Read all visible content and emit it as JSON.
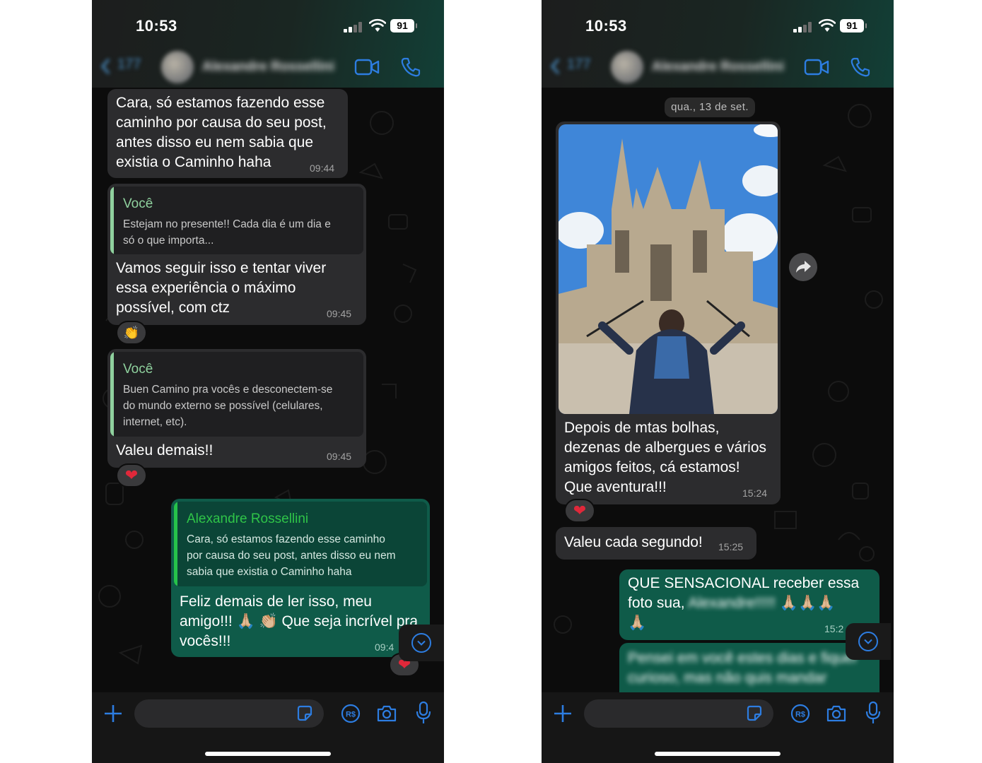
{
  "colors": {
    "incoming_bubble": "#2c2c2e",
    "outgoing_bubble": "#0f5b49",
    "accent_blue": "#2d7de1",
    "quote_author_green": "#8fd19e",
    "out_quote_author_green": "#2fc448"
  },
  "left": {
    "status": {
      "time": "10:53",
      "battery": "91"
    },
    "header": {
      "back_count": "177",
      "contact_name": "Alexandre Rossellini"
    },
    "messages": {
      "m1": {
        "line1": "Cara, só estamos fazendo esse",
        "line2": "caminho por causa do seu post,",
        "line3": "antes disso eu nem sabia que",
        "line4": "existia o Caminho haha",
        "time": "09:44"
      },
      "m2": {
        "quote_author": "Você",
        "quote_line1": "Estejam no presente!! Cada dia é um dia e",
        "quote_line2": "só o que importa...",
        "line1": "Vamos seguir isso e tentar viver",
        "line2": "essa experiência o máximo",
        "line3": "possível, com ctz",
        "time": "09:45",
        "reaction": "👏"
      },
      "m3": {
        "quote_author": "Você",
        "quote_line1": "Buen Camino pra vocês e desconectem-se",
        "quote_line2": "do mundo externo se possível (celulares,",
        "quote_line3": "internet, etc).",
        "line1": "Valeu demais!!",
        "time": "09:45",
        "reaction": "❤"
      },
      "m4": {
        "quote_author": "Alexandre Rossellini",
        "quote_line1": "Cara, só estamos fazendo esse caminho",
        "quote_line2": "por causa do seu post, antes disso eu nem",
        "quote_line3": "sabia que existia o Caminho haha",
        "line1": "Feliz demais de ler isso, meu",
        "line2": "amigo!!! 🙏🏼 👏🏼 Que seja incrível pra",
        "line3": "vocês!!!",
        "time": "09:4",
        "reaction": "❤"
      }
    }
  },
  "right": {
    "status": {
      "time": "10:53",
      "battery": "91"
    },
    "header": {
      "back_count": "177",
      "contact_name": "Alexandre Rossellini"
    },
    "date_separator": "qua., 13 de set.",
    "messages": {
      "photo_msg": {
        "photo_icon": "cathedral-photo",
        "line1": "Depois de mtas bolhas,",
        "line2": "dezenas de albergues e vários",
        "line3": "amigos feitos, cá estamos!",
        "line4": "Que aventura!!!",
        "time": "15:24",
        "reaction": "❤"
      },
      "m2": {
        "text": "Valeu cada segundo!",
        "time": "15:25"
      },
      "m3": {
        "line1": "QUE SENSACIONAL receber essa",
        "line2_prefix": "foto sua,",
        "line2_blur": "Alexandre!!!!!",
        "line2_emoji": "🙏🏼🙏🏼🙏🏼",
        "line3": "🙏🏼",
        "time": "15:2"
      },
      "m4": {
        "line1": "Pensei em você estes dias e fiquei",
        "line2": "curioso, mas não quis mandar"
      }
    }
  },
  "composer": {
    "plus_icon": "plus-icon",
    "sticker_icon": "sticker-icon",
    "pay_icon_label": "R$",
    "camera_icon": "camera-icon",
    "mic_icon": "microphone-icon"
  }
}
